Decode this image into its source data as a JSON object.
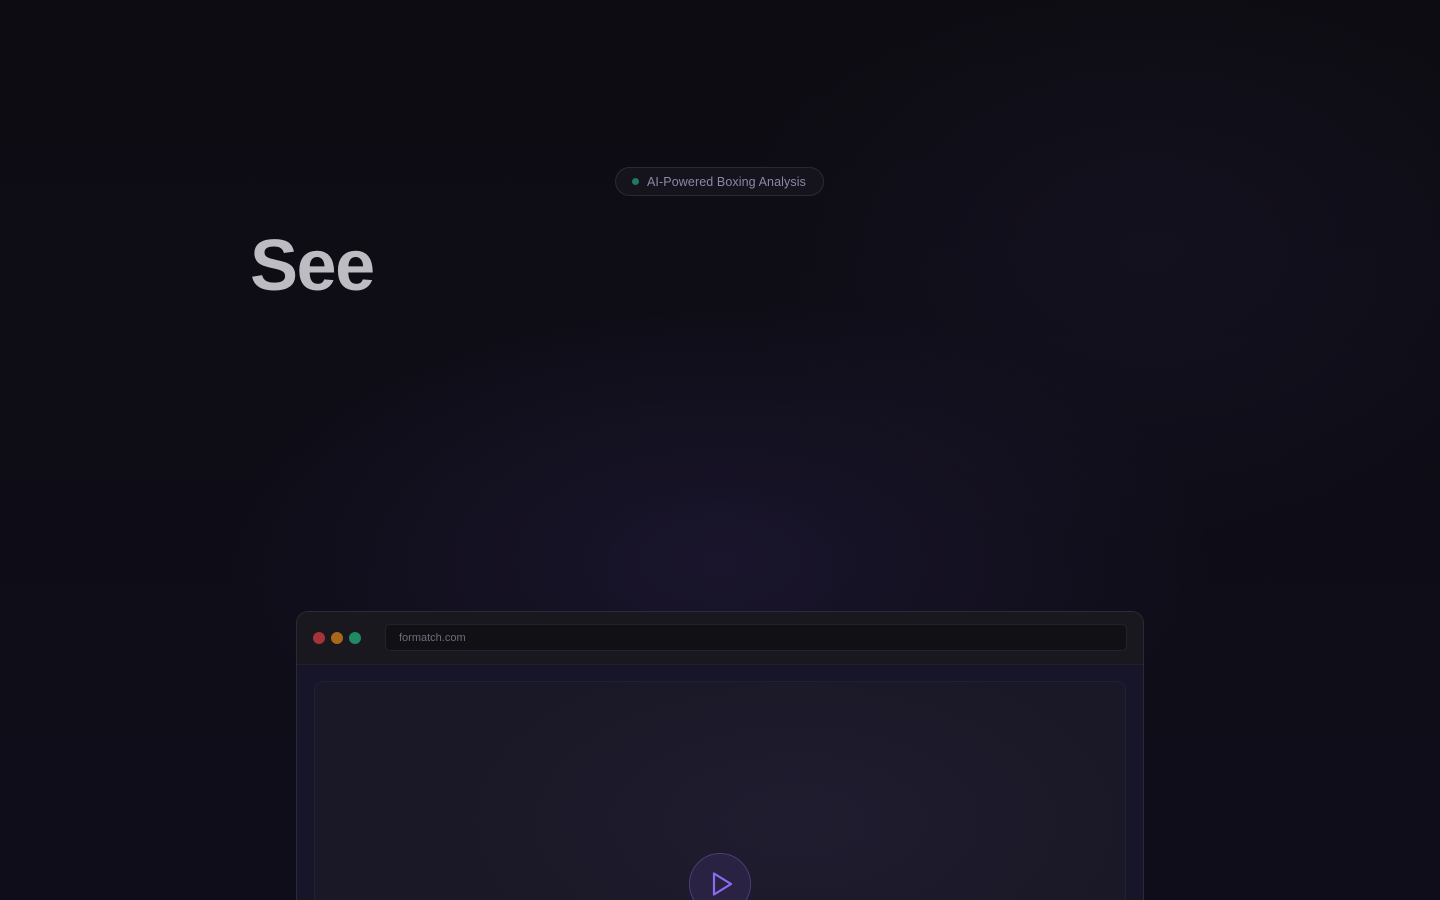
{
  "hero": {
    "badge_text": "AI-Powered Boxing Analysis",
    "headline": "See"
  },
  "browser_mockup": {
    "address": "formatch.com",
    "traffic_lights": [
      "close",
      "minimize",
      "maximize"
    ],
    "play_icon": "play-icon"
  },
  "colors": {
    "background": "#0c0b12",
    "badge_dot": "#1f7a5e",
    "accent_purple": "#8b6cf0",
    "traffic_red": "#a4343a",
    "traffic_yellow": "#a8681a",
    "traffic_green": "#1f8a63"
  }
}
